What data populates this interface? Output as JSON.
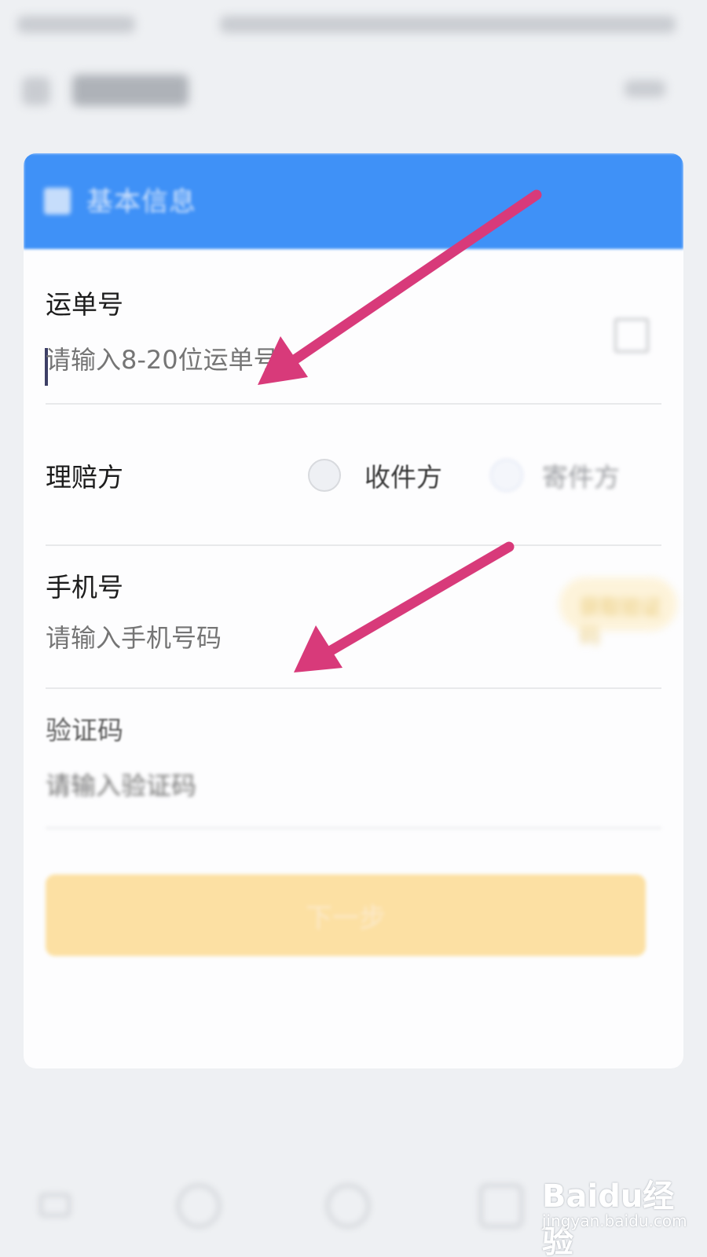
{
  "form": {
    "section_title": "基本信息",
    "waybill": {
      "label": "运单号",
      "placeholder": "请输入8-20位运单号"
    },
    "claimant": {
      "label": "理赔方",
      "options": [
        "收件方",
        "寄件方"
      ]
    },
    "phone": {
      "label": "手机号",
      "placeholder": "请输入手机号码"
    },
    "code": {
      "label": "验证码",
      "placeholder": "请输入验证码",
      "send_button": "获取验证码"
    },
    "next_button": "下一步"
  },
  "watermark": {
    "main": "Baidu经验",
    "sub": "jingyan.baidu.com"
  },
  "colors": {
    "header": "#3f91f7",
    "next_button": "#fce0a3",
    "annotation_arrow": "#d83a7a"
  }
}
